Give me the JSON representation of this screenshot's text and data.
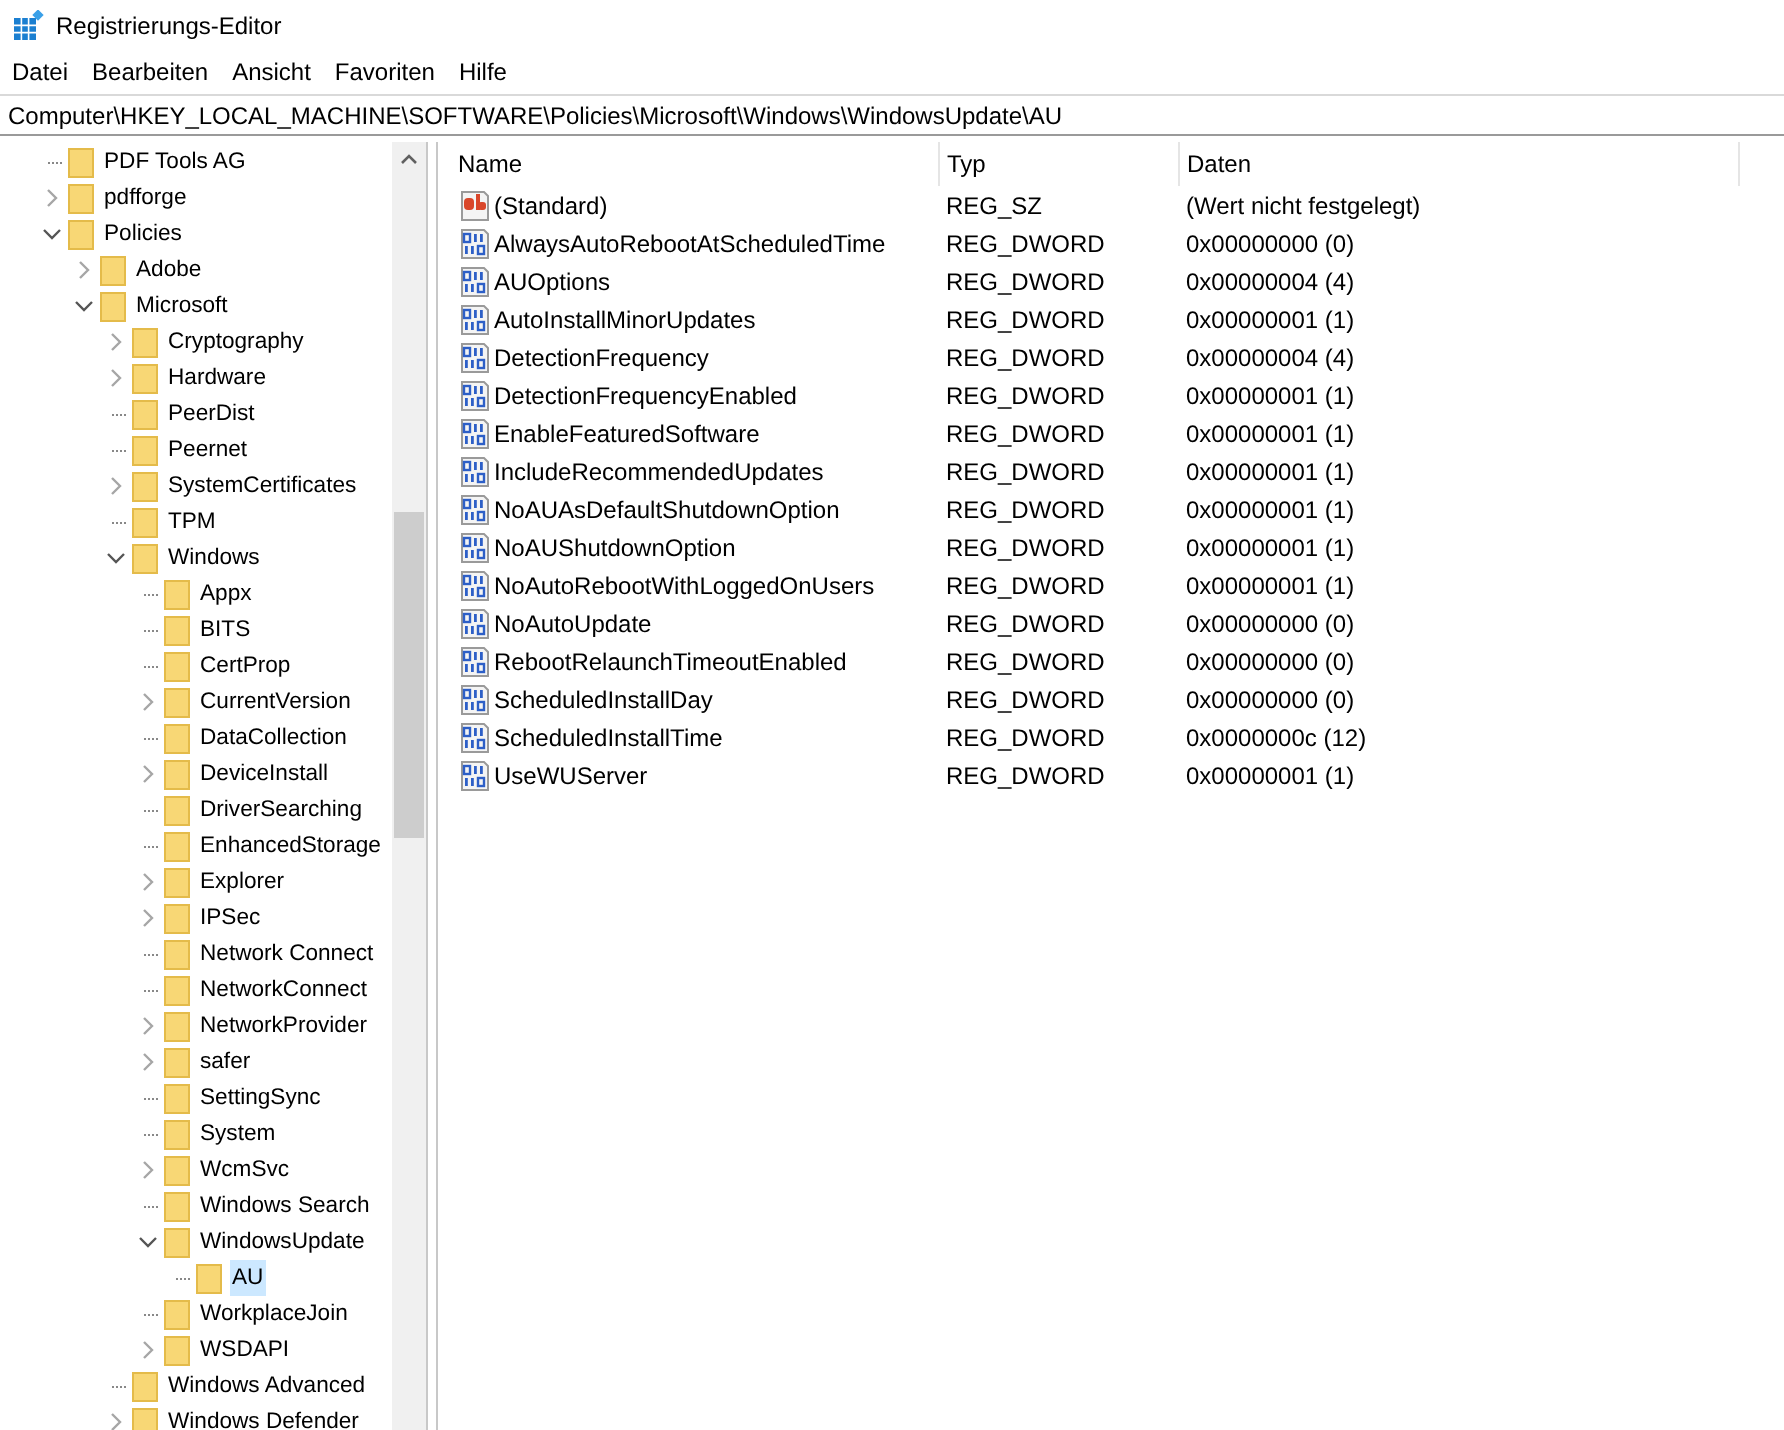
{
  "window": {
    "title": "Registrierungs-Editor"
  },
  "menu": [
    "Datei",
    "Bearbeiten",
    "Ansicht",
    "Favoriten",
    "Hilfe"
  ],
  "address": "Computer\\HKEY_LOCAL_MACHINE\\SOFTWARE\\Policies\\Microsoft\\Windows\\WindowsUpdate\\AU",
  "tree": [
    {
      "label": "PDF Tools AG",
      "selected": false
    },
    {
      "label": "pdfforge",
      "expanded": false,
      "selected": false
    },
    {
      "label": "Policies",
      "expanded": true,
      "selected": false,
      "children": [
        {
          "label": "Adobe",
          "expanded": false,
          "selected": false
        },
        {
          "label": "Microsoft",
          "expanded": true,
          "selected": false,
          "children": [
            {
              "label": "Cryptography",
              "expanded": false,
              "selected": false
            },
            {
              "label": "Hardware",
              "expanded": false,
              "selected": false
            },
            {
              "label": "PeerDist",
              "selected": false
            },
            {
              "label": "Peernet",
              "selected": false
            },
            {
              "label": "SystemCertificates",
              "expanded": false,
              "selected": false
            },
            {
              "label": "TPM",
              "selected": false
            },
            {
              "label": "Windows",
              "expanded": true,
              "selected": false,
              "children": [
                {
                  "label": "Appx",
                  "selected": false
                },
                {
                  "label": "BITS",
                  "selected": false
                },
                {
                  "label": "CertProp",
                  "selected": false
                },
                {
                  "label": "CurrentVersion",
                  "expanded": false,
                  "selected": false
                },
                {
                  "label": "DataCollection",
                  "selected": false
                },
                {
                  "label": "DeviceInstall",
                  "expanded": false,
                  "selected": false
                },
                {
                  "label": "DriverSearching",
                  "selected": false
                },
                {
                  "label": "EnhancedStorage",
                  "selected": false
                },
                {
                  "label": "Explorer",
                  "expanded": false,
                  "selected": false
                },
                {
                  "label": "IPSec",
                  "expanded": false,
                  "selected": false
                },
                {
                  "label": "Network Connect",
                  "selected": false
                },
                {
                  "label": "NetworkConnect",
                  "selected": false
                },
                {
                  "label": "NetworkProvider",
                  "expanded": false,
                  "selected": false
                },
                {
                  "label": "safer",
                  "expanded": false,
                  "selected": false
                },
                {
                  "label": "SettingSync",
                  "selected": false
                },
                {
                  "label": "System",
                  "selected": false
                },
                {
                  "label": "WcmSvc",
                  "expanded": false,
                  "selected": false
                },
                {
                  "label": "Windows Search",
                  "selected": false
                },
                {
                  "label": "WindowsUpdate",
                  "expanded": true,
                  "selected": false,
                  "children": [
                    {
                      "label": "AU",
                      "selected": true
                    }
                  ]
                },
                {
                  "label": "WorkplaceJoin",
                  "selected": false
                },
                {
                  "label": "WSDAPI",
                  "expanded": false,
                  "selected": false
                }
              ]
            },
            {
              "label": "Windows Advanced",
              "selected": false
            },
            {
              "label": "Windows Defender",
              "expanded": false,
              "selected": false
            }
          ]
        }
      ]
    }
  ],
  "table": {
    "columns": [
      "Name",
      "Typ",
      "Daten"
    ],
    "rows": [
      {
        "kind": "string",
        "name": "(Standard)",
        "type": "REG_SZ",
        "data": "(Wert nicht festgelegt)"
      },
      {
        "kind": "dword",
        "name": "AlwaysAutoRebootAtScheduledTime",
        "type": "REG_DWORD",
        "data": "0x00000000 (0)"
      },
      {
        "kind": "dword",
        "name": "AUOptions",
        "type": "REG_DWORD",
        "data": "0x00000004 (4)"
      },
      {
        "kind": "dword",
        "name": "AutoInstallMinorUpdates",
        "type": "REG_DWORD",
        "data": "0x00000001 (1)"
      },
      {
        "kind": "dword",
        "name": "DetectionFrequency",
        "type": "REG_DWORD",
        "data": "0x00000004 (4)"
      },
      {
        "kind": "dword",
        "name": "DetectionFrequencyEnabled",
        "type": "REG_DWORD",
        "data": "0x00000001 (1)"
      },
      {
        "kind": "dword",
        "name": "EnableFeaturedSoftware",
        "type": "REG_DWORD",
        "data": "0x00000001 (1)"
      },
      {
        "kind": "dword",
        "name": "IncludeRecommendedUpdates",
        "type": "REG_DWORD",
        "data": "0x00000001 (1)"
      },
      {
        "kind": "dword",
        "name": "NoAUAsDefaultShutdownOption",
        "type": "REG_DWORD",
        "data": "0x00000001 (1)"
      },
      {
        "kind": "dword",
        "name": "NoAUShutdownOption",
        "type": "REG_DWORD",
        "data": "0x00000001 (1)"
      },
      {
        "kind": "dword",
        "name": "NoAutoRebootWithLoggedOnUsers",
        "type": "REG_DWORD",
        "data": "0x00000001 (1)"
      },
      {
        "kind": "dword",
        "name": "NoAutoUpdate",
        "type": "REG_DWORD",
        "data": "0x00000000 (0)"
      },
      {
        "kind": "dword",
        "name": "RebootRelaunchTimeoutEnabled",
        "type": "REG_DWORD",
        "data": "0x00000000 (0)"
      },
      {
        "kind": "dword",
        "name": "ScheduledInstallDay",
        "type": "REG_DWORD",
        "data": "0x00000000 (0)"
      },
      {
        "kind": "dword",
        "name": "ScheduledInstallTime",
        "type": "REG_DWORD",
        "data": "0x0000000c (12)"
      },
      {
        "kind": "dword",
        "name": "UseWUServer",
        "type": "REG_DWORD",
        "data": "0x00000001 (1)"
      }
    ]
  }
}
